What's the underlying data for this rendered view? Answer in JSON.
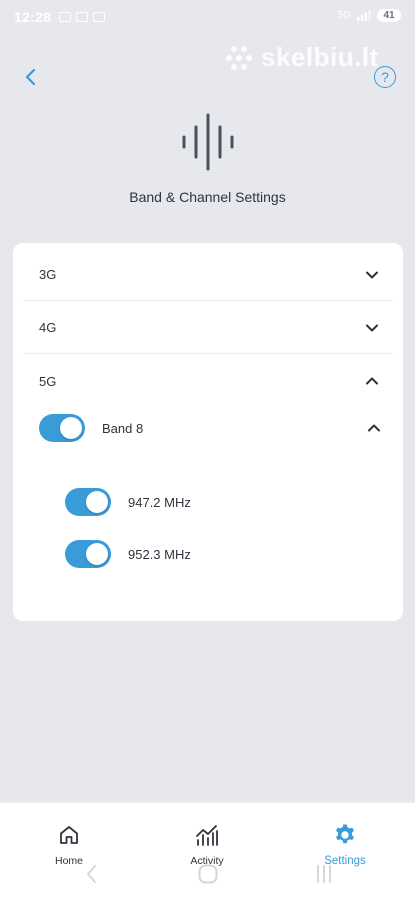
{
  "status_bar": {
    "time": "12:28",
    "network": "5G",
    "battery": "41"
  },
  "watermark": {
    "text": "skelbiu.lt"
  },
  "header": {
    "title": "Band & Channel Settings",
    "help_symbol": "?"
  },
  "accordion": [
    {
      "label": "3G",
      "expanded": false
    },
    {
      "label": "4G",
      "expanded": false
    },
    {
      "label": "5G",
      "expanded": true
    }
  ],
  "band": {
    "label": "Band 8",
    "enabled": true,
    "expanded": true
  },
  "channels": [
    {
      "label": "947.2 MHz",
      "enabled": true
    },
    {
      "label": "952.3 MHz",
      "enabled": true
    }
  ],
  "bottom_nav": {
    "items": [
      {
        "label": "Home",
        "icon": "home-icon",
        "active": false
      },
      {
        "label": "Activity",
        "icon": "activity-chart-icon",
        "active": false
      },
      {
        "label": "Settings",
        "icon": "gear-icon",
        "active": true
      }
    ]
  },
  "colors": {
    "accent": "#3a9bd9",
    "background": "#e6e8ee",
    "card": "#ffffff",
    "text": "#2f333b"
  }
}
